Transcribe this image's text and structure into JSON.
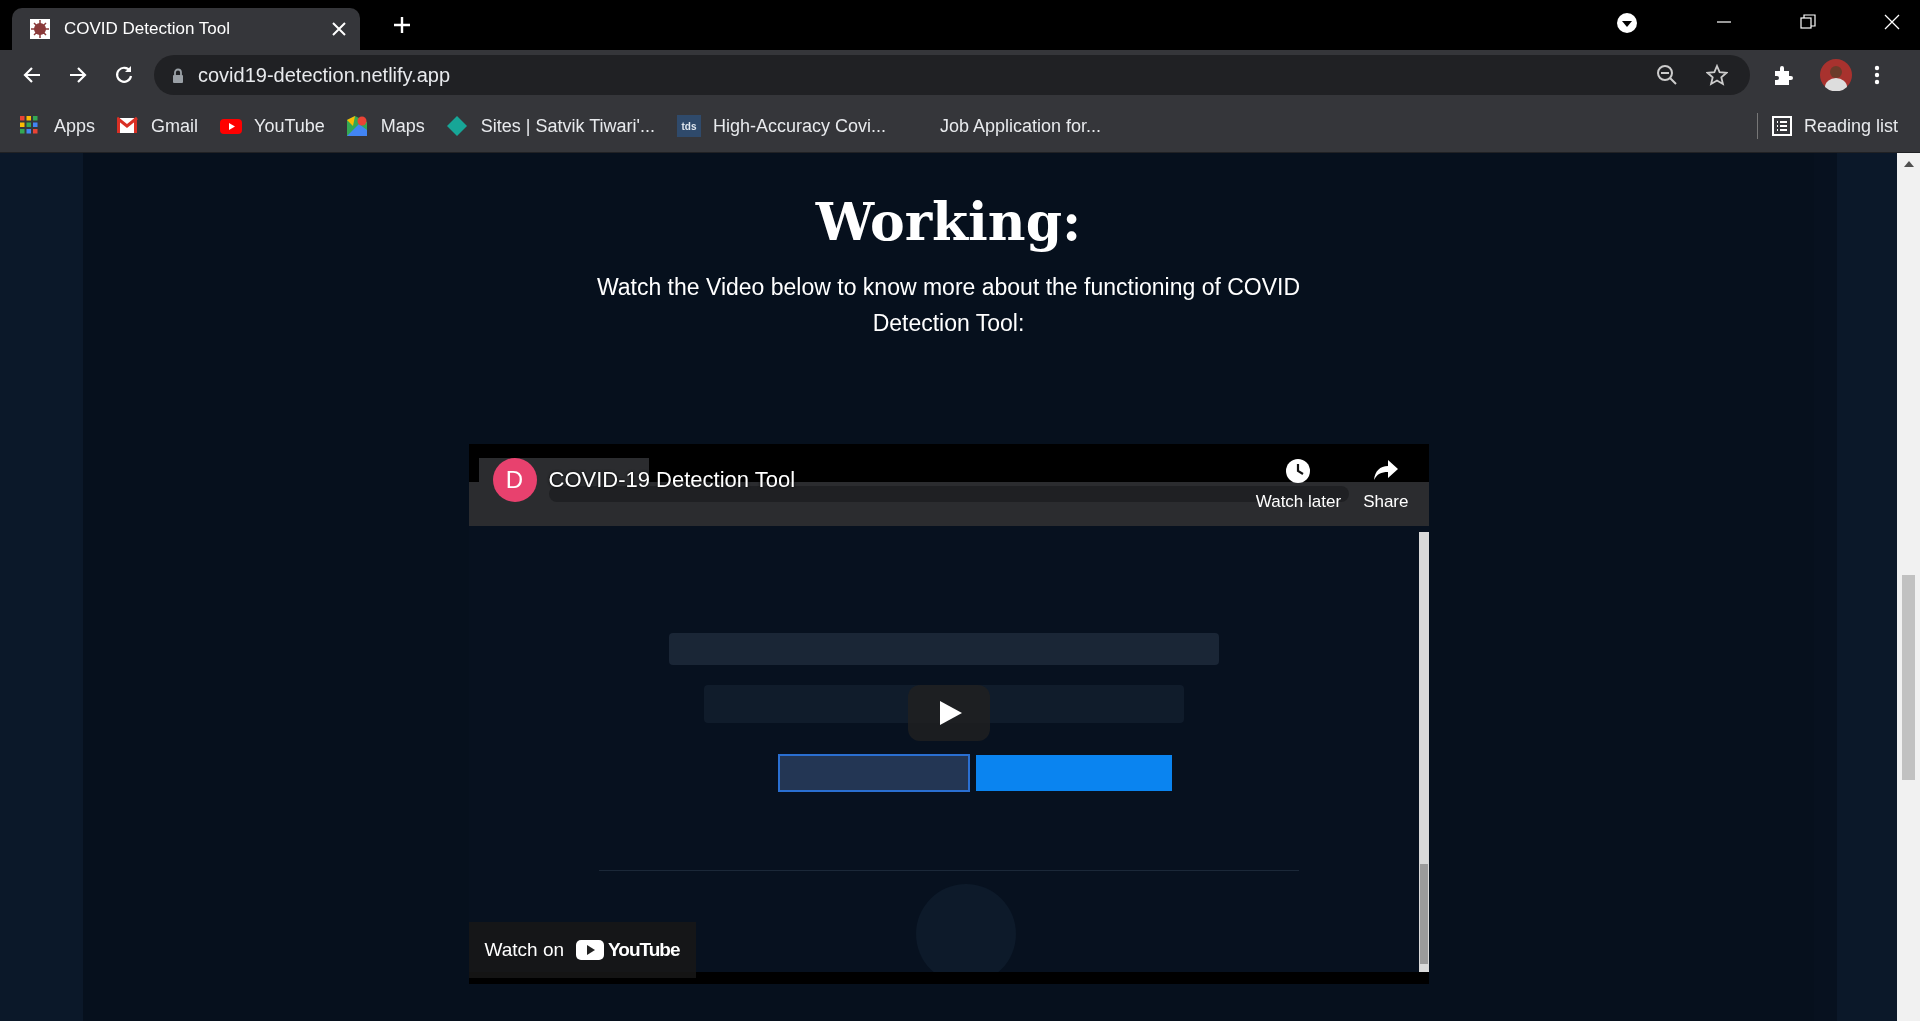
{
  "browser": {
    "tabs": [
      {
        "title": "COVID Detection Tool",
        "selected": true
      }
    ],
    "url": "covid19-detection.netlify.app",
    "bookmarks": [
      {
        "kind": "apps",
        "label": "Apps"
      },
      {
        "kind": "gmail",
        "label": "Gmail"
      },
      {
        "kind": "youtube",
        "label": "YouTube"
      },
      {
        "kind": "maps",
        "label": "Maps"
      },
      {
        "kind": "sites",
        "label": "Sites | Satvik Tiwari'..."
      },
      {
        "kind": "tds",
        "badge": "tds",
        "label": "High-Accuracy Covi..."
      },
      {
        "kind": "blank",
        "label": "Job Application for..."
      }
    ],
    "reading_list": "Reading list"
  },
  "page": {
    "heading": "Working:",
    "intro": "Watch the Video below to know more about the functioning of COVID Detection Tool:",
    "video": {
      "kind": "picture",
      "channel_initial": "D",
      "title": "COVID-19 Detection Tool",
      "watch_later": "Watch later",
      "share": "Share",
      "watch_on": "Watch on",
      "brand": "YouTube"
    }
  }
}
